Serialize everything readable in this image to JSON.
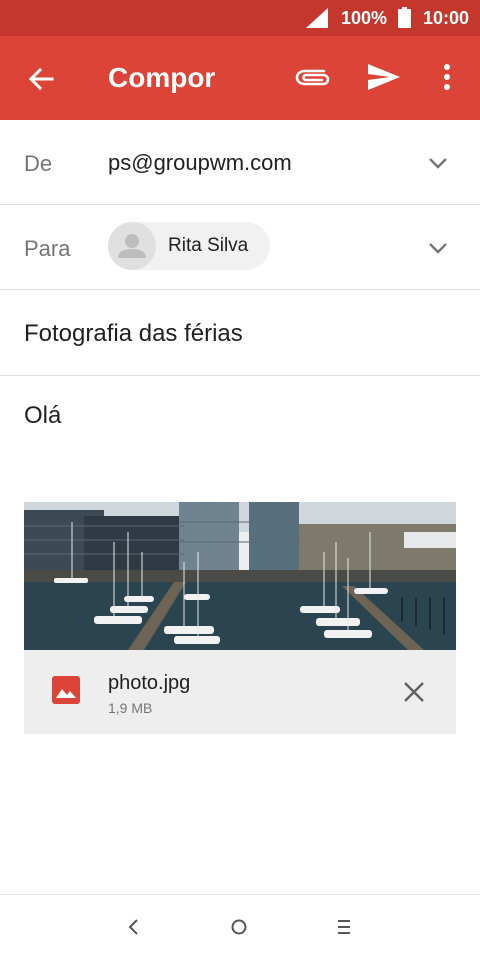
{
  "status_bar": {
    "battery_percent": "100%",
    "time": "10:00",
    "icons": [
      "signal-icon",
      "battery-icon"
    ]
  },
  "app_bar": {
    "title": "Compor",
    "icons": [
      "back-arrow-icon",
      "paperclip-icon",
      "send-icon",
      "more-vert-icon"
    ]
  },
  "from": {
    "label": "De",
    "value": "ps@groupwm.com"
  },
  "to": {
    "label": "Para",
    "recipient": "Rita Silva"
  },
  "subject": "Fotografia das férias",
  "body": "Olá",
  "attachment": {
    "file_name": "photo.jpg",
    "file_size": "1,9 MB",
    "icons": [
      "image-icon",
      "close-icon"
    ]
  },
  "colors": {
    "status_bar": "#c5372c",
    "app_bar": "#db4437",
    "attachment_icon": "#db4437"
  }
}
